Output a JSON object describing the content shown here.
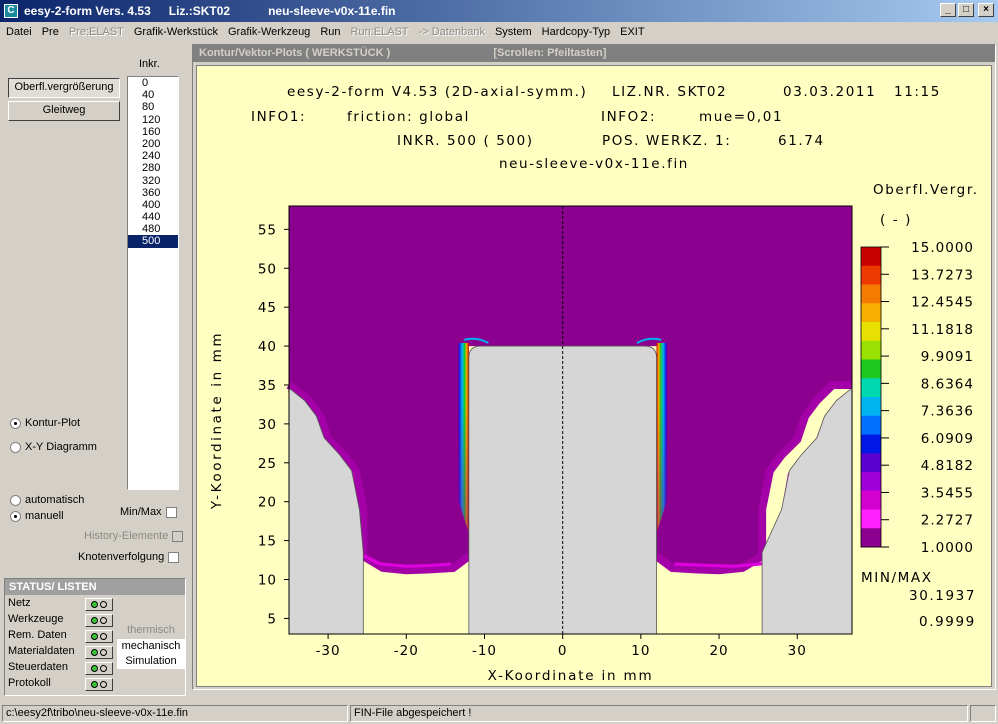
{
  "window": {
    "app_name": "eesy-2-form Vers. 4.53",
    "license": "Liz.:SKT02",
    "file": "neu-sleeve-v0x-11e.fin",
    "btn_min": "_",
    "btn_max": "□",
    "btn_close": "×"
  },
  "menu": [
    "Datei",
    "Pre",
    "Pre:ELAST",
    "Grafik-Werkstück",
    "Grafik-Werkzeug",
    "Run",
    "Run:ELAST",
    "-> Datenbank",
    "System",
    "Hardcopy-Typ",
    "EXIT"
  ],
  "menu_disabled": [
    2,
    6,
    7
  ],
  "left": {
    "btn_surface": "Oberfl.vergrößerung",
    "btn_glide": "Gleitweg",
    "inkr_label": "Inkr.",
    "increments": [
      "0",
      "40",
      "80",
      "120",
      "160",
      "200",
      "240",
      "280",
      "320",
      "360",
      "400",
      "440",
      "480",
      "500"
    ],
    "selected_increment": "500",
    "radio_contour": "Kontur-Plot",
    "radio_xy": "X-Y Diagramm",
    "plot_mode": "contour",
    "radio_auto": "automatisch",
    "radio_manual": "manuell",
    "scale_mode": "manual",
    "chk_minmax": "Min/Max",
    "chk_history": "History-Elemente",
    "chk_nodes": "Knotenverfolgung"
  },
  "status": {
    "title": "STATUS/ LISTEN",
    "rows": [
      "Netz",
      "Werkzeuge",
      "Rem. Daten",
      "Materialdaten",
      "Steuerdaten",
      "Protokoll"
    ],
    "mode_thermal": "thermisch",
    "mode_mech": "mechanisch",
    "mode_sim": "Simulation"
  },
  "plot_window": {
    "title": "Kontur/Vektor-Plots ( WERKSTÜCK )",
    "scroll_hint": "[Scrollen: Pfeiltasten]"
  },
  "plot": {
    "line1_prog": "eesy-2-form V4.53 (2D-axial-symm.)",
    "line1_lic": "LIZ.NR. SKT02",
    "line1_date": "03.03.2011",
    "line1_time": "11:15",
    "info1_label": "INFO1:",
    "info1_val": "friction: global",
    "info2_label": "INFO2:",
    "info2_val": "mue=0,01",
    "inkr": "INKR.  500 ( 500)",
    "pos": "POS. WERKZ. 1:",
    "pos_val": "61.74",
    "filename": "neu-sleeve-v0x-11e.fin",
    "legend_title": "Oberfl.Vergr.",
    "legend_unit": "( - )",
    "minmax_label": "MIN/MAX",
    "max_val": "30.1937",
    "min_val": "0.9999"
  },
  "chart_data": {
    "type": "heatmap",
    "xlabel": "X-Koordinate in mm",
    "ylabel": "Y-Koordinate in mm",
    "xlim": [
      -35,
      37
    ],
    "ylim": [
      3,
      58
    ],
    "x_ticks": [
      -30,
      -20,
      -10,
      0,
      10,
      20,
      30
    ],
    "y_ticks": [
      5,
      10,
      15,
      20,
      25,
      30,
      35,
      40,
      45,
      50,
      55
    ],
    "legend_values": [
      "15.0000",
      "13.7273",
      "12.4545",
      "11.1818",
      "9.9091",
      "8.6364",
      "7.3636",
      "6.0909",
      "4.8182",
      "3.5455",
      "2.2727",
      "1.0000"
    ],
    "legend_colors": [
      "#c80000",
      "#ec3a00",
      "#f47a00",
      "#f8b000",
      "#e8e000",
      "#9ae000",
      "#1ec81e",
      "#00d8b0",
      "#00b4f0",
      "#0070ff",
      "#0018e6",
      "#5a00d0",
      "#a000d8",
      "#d400d0",
      "#ff20ff",
      "#8c0090"
    ],
    "colors": {
      "bulk": "#8c0090",
      "edge": "#a400a8",
      "tool": "#d6d6d6",
      "background": "#ffffc2",
      "hot": "#c80000"
    }
  },
  "statusbar": {
    "path": "c:\\eesy2f\\tribo\\neu-sleeve-v0x-11e.fin",
    "message": "FIN-File abgespeichert !"
  }
}
